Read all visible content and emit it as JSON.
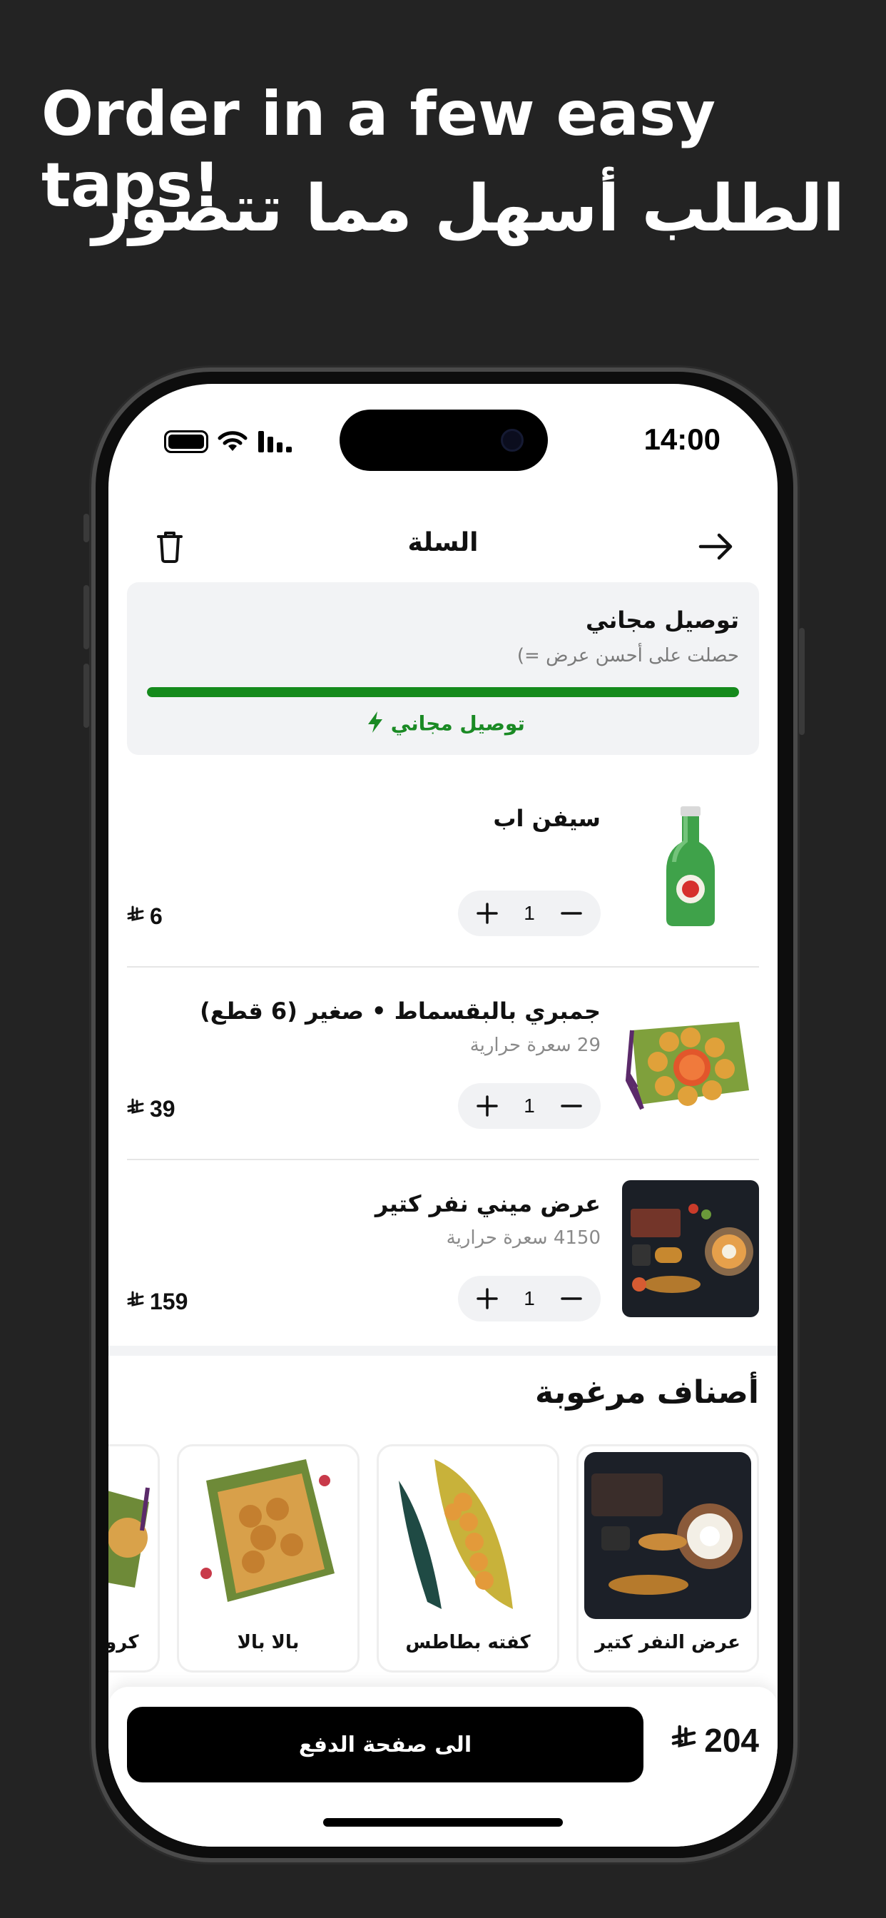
{
  "marketing": {
    "headline_en": "Order in a few easy taps!",
    "headline_ar": "الطلب أسهل مما تتصور"
  },
  "status_bar": {
    "time": "14:00"
  },
  "nav": {
    "title": "السلة",
    "trash_icon": "trash-icon",
    "back_icon": "arrow-right-icon"
  },
  "promo": {
    "title": "توصيل مجاني",
    "subtitle": "حصلت على أحسن عرض =)",
    "progress": 1.0,
    "badge": "توصيل مجاني",
    "accent": "#158a1c"
  },
  "currency_symbol": "⃁",
  "cart_items": [
    {
      "name": "سيفن اب",
      "calories": "",
      "qty": "1",
      "price": "6"
    },
    {
      "name": "جمبري بالبقسماط • صغير (6 قطع)",
      "calories": "29 سعرة حرارية",
      "qty": "1",
      "price": "39"
    },
    {
      "name": "عرض ميني نفر كتير",
      "calories": "4150 سعرة حرارية",
      "qty": "1",
      "price": "159"
    }
  ],
  "suggestions": {
    "title": "أصناف مرغوبة",
    "items": [
      {
        "label": "عرض النفر كتير"
      },
      {
        "label": "كفته بطاطس"
      },
      {
        "label": "بالا بالا"
      },
      {
        "label": "كروبو"
      }
    ]
  },
  "checkout": {
    "button_label": "الى صفحة الدفع",
    "total": "204"
  }
}
